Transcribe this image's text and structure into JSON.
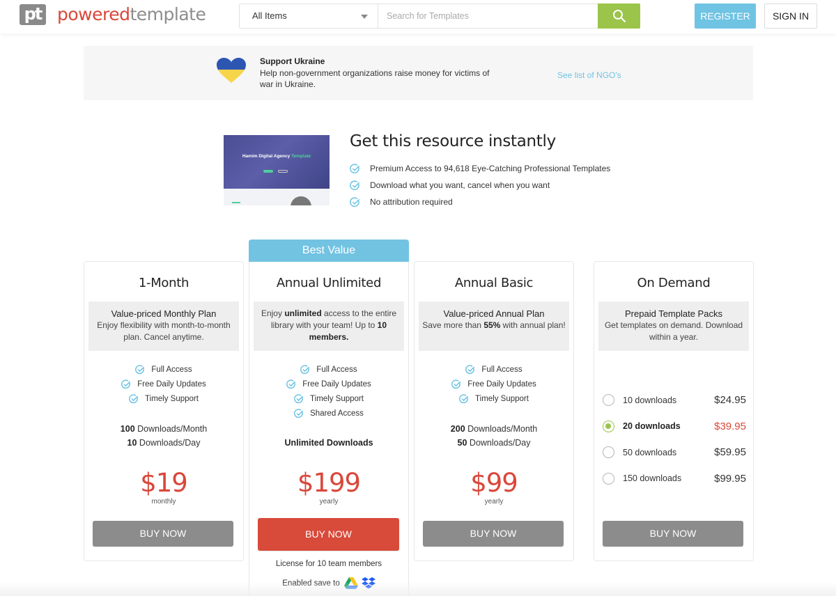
{
  "header": {
    "logo_mark": "pt",
    "logo_word_1": "powered",
    "logo_word_2": "template",
    "category_select": "All Items",
    "search_placeholder": "Search for Templates",
    "search_value": "",
    "register_label": "REGISTER",
    "signin_label": "SIGN IN"
  },
  "banner": {
    "title": "Support Ukraine",
    "text": "Help non-government organizations raise money for victims of war in Ukraine.",
    "link": "See list of NGO's"
  },
  "resource": {
    "thumbnail_title_1": "Hamim Digital Agency",
    "thumbnail_title_2": "Template",
    "title": "Get this resource instantly",
    "benefits": [
      "Premium Access to 94,618 Eye-Catching Professional Templates",
      "Download what you want, cancel when you want",
      "No attribution required"
    ]
  },
  "plans": [
    {
      "name": "1-Month",
      "desc_title": "Value-priced Monthly Plan",
      "desc_text": "Enjoy flexibility with month-to-month plan. Cancel anytime.",
      "features": [
        "Full Access",
        "Free Daily Updates",
        "Timely Support"
      ],
      "downloads_month_num": "100",
      "downloads_month_label": "Downloads/Month",
      "downloads_day_num": "10",
      "downloads_day_label": "Downloads/Day",
      "price": "$19",
      "period": "monthly",
      "buy_label": "BUY NOW"
    },
    {
      "badge": "Best Value",
      "name": "Annual Unlimited",
      "desc_1": "Enjoy ",
      "desc_bold_1": "unlimited",
      "desc_2": " access to the entire library with your team! Up to ",
      "desc_bold_2": "10",
      "desc_bold_3": "members.",
      "features": [
        "Full Access",
        "Free Daily Updates",
        "Timely Support",
        "Shared Access"
      ],
      "downloads": "Unlimited Downloads",
      "price": "$199",
      "period": "yearly",
      "buy_label": "BUY NOW",
      "license": "License for 10 team members",
      "save_to": "Enabled save to",
      "save_targets": [
        "google-drive",
        "dropbox"
      ]
    },
    {
      "name": "Annual Basic",
      "desc_title": "Value-priced Annual Plan",
      "desc_1": "Save more than ",
      "desc_bold": "55%",
      "desc_2": " with annual plan!",
      "features": [
        "Full Access",
        "Free Daily Updates",
        "Timely Support"
      ],
      "downloads_month_num": "200",
      "downloads_month_label": "Downloads/Month",
      "downloads_day_num": "50",
      "downloads_day_label": "Downloads/Day",
      "price": "$99",
      "period": "yearly",
      "buy_label": "BUY NOW"
    },
    {
      "name": "On Demand",
      "desc_title": "Prepaid Template Packs",
      "desc_text": "Get templates on demand. Download within a year.",
      "options": [
        {
          "label": "10 downloads",
          "price": "$24.95",
          "selected": false
        },
        {
          "label": "20 downloads",
          "price": "$39.95",
          "selected": true
        },
        {
          "label": "50 downloads",
          "price": "$59.95",
          "selected": false
        },
        {
          "label": "150 downloads",
          "price": "$99.95",
          "selected": false
        }
      ],
      "buy_label": "BUY NOW"
    }
  ],
  "colors": {
    "brand_red": "#d9473a",
    "accent_blue": "#72c3e2",
    "search_green": "#9bc44a",
    "buy_gray": "#8c8c8c"
  }
}
